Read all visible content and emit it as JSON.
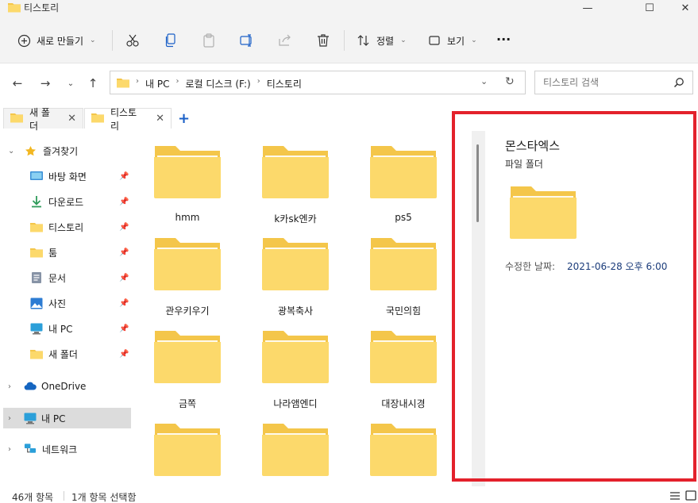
{
  "window": {
    "title": "티스토리",
    "minimize_label": "—",
    "maximize_label": "☐",
    "close_label": "✕"
  },
  "toolbar": {
    "new_label": "새로 만들기",
    "sort_label": "정렬",
    "view_label": "보기",
    "more_label": "···"
  },
  "address": {
    "crumbs": [
      "내 PC",
      "로컬 디스크 (F:)",
      "티스토리"
    ],
    "search_placeholder": "티스토리 검색"
  },
  "tabs": [
    {
      "label": "새 폴더",
      "active": false
    },
    {
      "label": "티스토리",
      "active": true
    }
  ],
  "sidebar": {
    "quick_access": "즐겨찾기",
    "pinned": [
      {
        "label": "바탕 화면",
        "icon": "desktop-icon"
      },
      {
        "label": "다운로드",
        "icon": "download-icon"
      },
      {
        "label": "티스토리",
        "icon": "folder-icon"
      },
      {
        "label": "툼",
        "icon": "folder-icon"
      },
      {
        "label": "문서",
        "icon": "document-icon"
      },
      {
        "label": "사진",
        "icon": "pictures-icon"
      },
      {
        "label": "내 PC",
        "icon": "pc-icon"
      },
      {
        "label": "새 폴더",
        "icon": "folder-icon"
      }
    ],
    "onedrive": "OneDrive",
    "this_pc": "내 PC",
    "network": "네트워크"
  },
  "files": [
    {
      "name": "hmm"
    },
    {
      "name": "k카sk엔카"
    },
    {
      "name": "ps5"
    },
    {
      "name": "관우키우기"
    },
    {
      "name": "광복축사"
    },
    {
      "name": "국민의힘"
    },
    {
      "name": "금쪽"
    },
    {
      "name": "나라앰엔디"
    },
    {
      "name": "대장내시경"
    },
    {
      "name": ""
    },
    {
      "name": ""
    },
    {
      "name": ""
    }
  ],
  "details": {
    "name": "몬스타엑스",
    "type": "파일 폴더",
    "modified_label": "수정한 날짜:",
    "modified_value": "2021-06-28 오후 6:00"
  },
  "status": {
    "item_count": "46개 항목",
    "selected": "1개 항목 선택함"
  },
  "colors": {
    "folder_back": "#f4c64a",
    "folder_front": "#fcd96b",
    "highlight": "#e3212b",
    "accent": "#1a5fc7"
  }
}
